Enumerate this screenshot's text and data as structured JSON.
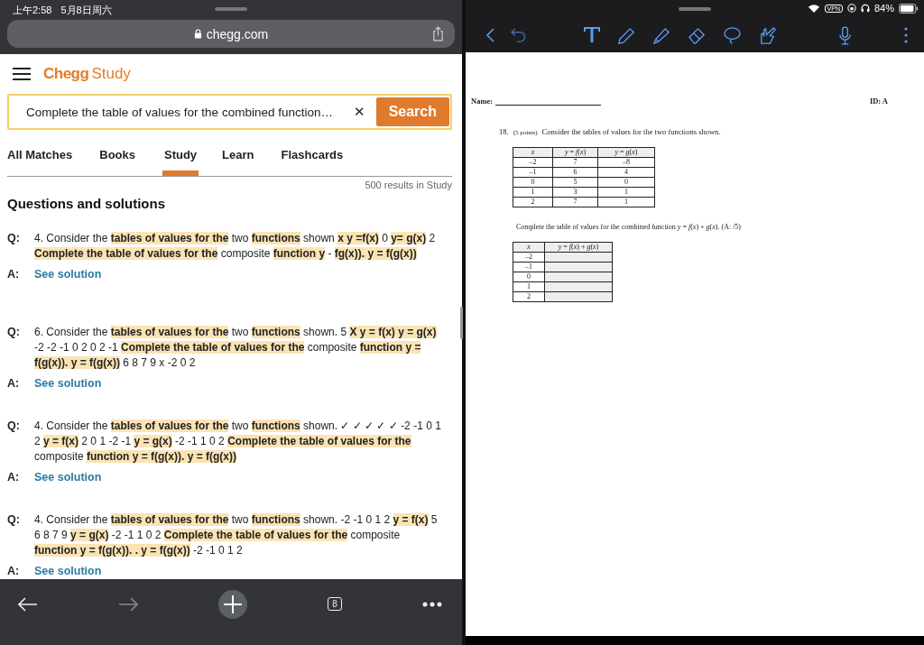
{
  "status_bar": {
    "time": "上午2:58",
    "date": "5月8日周六",
    "vpn": "VPN",
    "battery": "84%"
  },
  "browser": {
    "url": "chegg.com",
    "tab_count": "8"
  },
  "chegg": {
    "logo_bold": "Chegg",
    "logo_light": "Study",
    "search": {
      "value": "Complete the table of values for the combined function…",
      "clear": "✕",
      "button": "Search"
    },
    "tabs": [
      {
        "label": "All Matches",
        "selected": false
      },
      {
        "label": "Books",
        "selected": false
      },
      {
        "label": "Study",
        "selected": true
      },
      {
        "label": "Learn",
        "selected": false
      },
      {
        "label": "Flashcards",
        "selected": false
      }
    ],
    "results_count": "500 results in Study",
    "section_title": "Questions and solutions",
    "results": [
      {
        "q_label": "Q:",
        "question": "4. Consider the **tables of values for the** two **functions** shown **x y =f(x)** 0 **y= g(x)** 2 **Complete the table of values for the** composite **function y** - **fg(x)). y = f(g(x))**",
        "a_label": "A:",
        "answer": "See solution"
      },
      {
        "q_label": "Q:",
        "question": "6. Consider the **tables of values for the** two **functions** shown. 5 **X y = f(x) y = g(x)** -2 -2 -1 0 2 0 2 -1 **Complete the table of values for the** composite **function y = f(g(x)). y = f(g(x))** 6 8 7 9 x -2 0 2",
        "a_label": "A:",
        "answer": "See solution"
      },
      {
        "q_label": "Q:",
        "question": "4. Consider the **tables of values for the** two **functions** shown. ✓ ✓ ✓ ✓ ✓ -2 -1 0 1 2 **y = f(x)** 2 0 1 -2 -1 **y = g(x)** -2 -1 1 0 2 **Complete the table of values for the** composite **function y = f(g(x)). y = f(g(x))**",
        "a_label": "A:",
        "answer": "See solution"
      },
      {
        "q_label": "Q:",
        "question": "4. Consider the **tables of values for the** two **functions** shown. -2 -1 0 1 2 **y = f(x)** 5 6 8 7 9 **y = g(x)** -2 -1 1 0 2 **Complete the table of values for the** composite **function y = f(g(x)). . y = f(g(x))** -2 -1 0 1 2",
        "a_label": "A:",
        "answer": "See solution"
      }
    ]
  },
  "document": {
    "name_label": "Name:",
    "id_label": "ID: A",
    "number": "18.",
    "points": "(5 points)",
    "prompt": "Consider the tables of values for the two functions shown.",
    "table1": {
      "columns": [
        "*x*",
        "*y* = *f*(*x*)",
        "*y* = *g*(*x*)"
      ],
      "rows": [
        [
          "–2",
          "7",
          "–8"
        ],
        [
          "–1",
          "6",
          "4"
        ],
        [
          "0",
          "5",
          "0"
        ],
        [
          "1",
          "3",
          "1"
        ],
        [
          "2",
          "7",
          "1"
        ]
      ]
    },
    "instruction": "Complete the table of values for the combined function *y* = *f*(*x*) + *g*(*x*). (A:    /5)",
    "table2": {
      "columns": [
        "*x*",
        "*y* = *f*(*x*) + *g*(*x*)"
      ],
      "rows": [
        "–2",
        "–1",
        "0",
        "1",
        "2"
      ]
    }
  }
}
